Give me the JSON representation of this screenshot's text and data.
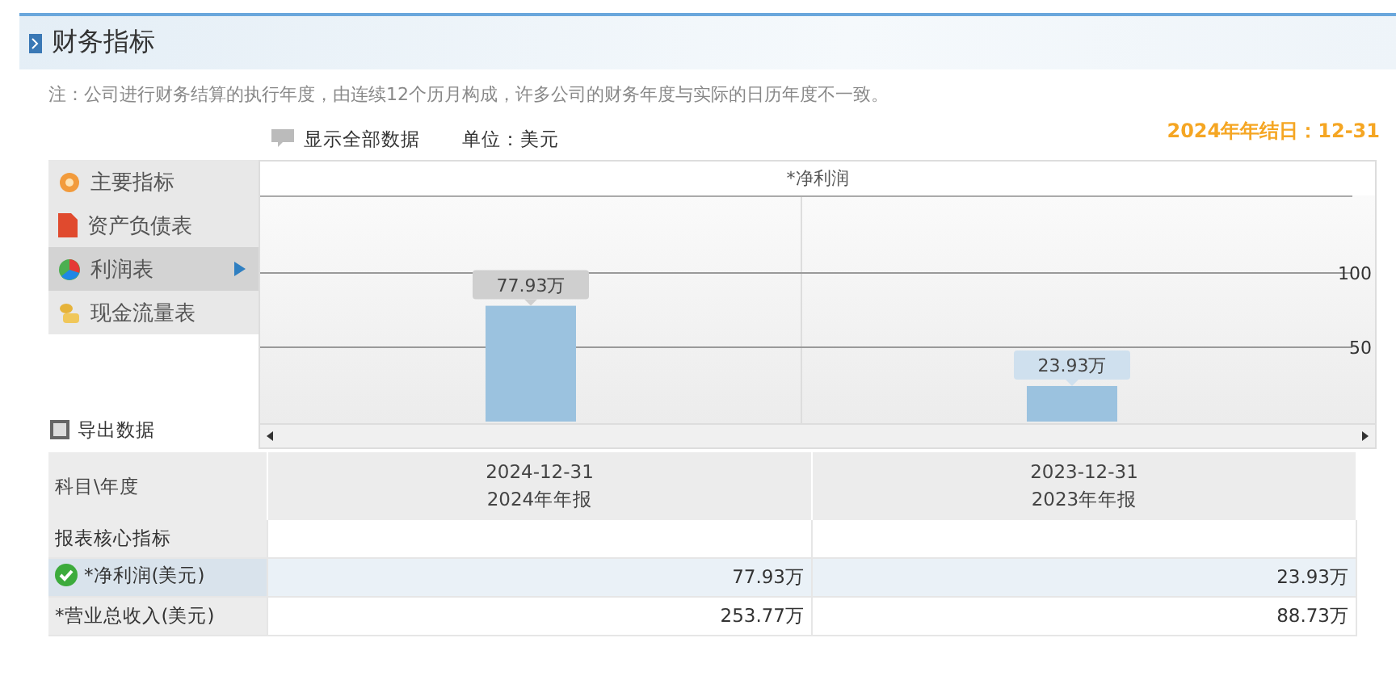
{
  "header": {
    "title": "财务指标"
  },
  "note": "注：公司进行财务结算的执行年度，由连续12个历月构成，许多公司的财务年度与实际的日历年度不一致。",
  "toolbar": {
    "show_all": "显示全部数据",
    "unit": "单位：美元"
  },
  "year_end": "2024年年结日：12-31",
  "sidebar": {
    "items": [
      {
        "label": "主要指标",
        "selected": false
      },
      {
        "label": "资产负债表",
        "selected": false
      },
      {
        "label": "利润表",
        "selected": true
      },
      {
        "label": "现金流量表",
        "selected": false
      }
    ]
  },
  "export": "导出数据",
  "chart": {
    "bars": [
      {
        "hovered": true
      },
      {
        "hovered": false
      }
    ],
    "chart_data": {
      "type": "bar",
      "title": "*净利润",
      "values": [
        77.93,
        23.93
      ],
      "ylim": [
        0,
        150
      ],
      "yticks": [
        50,
        100
      ],
      "value_labels": [
        "77.93万",
        "23.93万"
      ]
    }
  },
  "table": {
    "corner": "科目\\年度",
    "columns": [
      {
        "date": "2024-12-31",
        "label": "2024年年报"
      },
      {
        "date": "2023-12-31",
        "label": "2023年年报"
      }
    ],
    "rows": [
      {
        "kind": "section",
        "label": "报表核心指标",
        "selected": false,
        "values": []
      },
      {
        "kind": "data",
        "label": "*净利润(美元)",
        "selected": true,
        "values": [
          "77.93万",
          "23.93万"
        ]
      },
      {
        "kind": "data",
        "label": "*营业总收入(美元)",
        "selected": false,
        "values": [
          "253.77万",
          "88.73万"
        ]
      }
    ]
  }
}
